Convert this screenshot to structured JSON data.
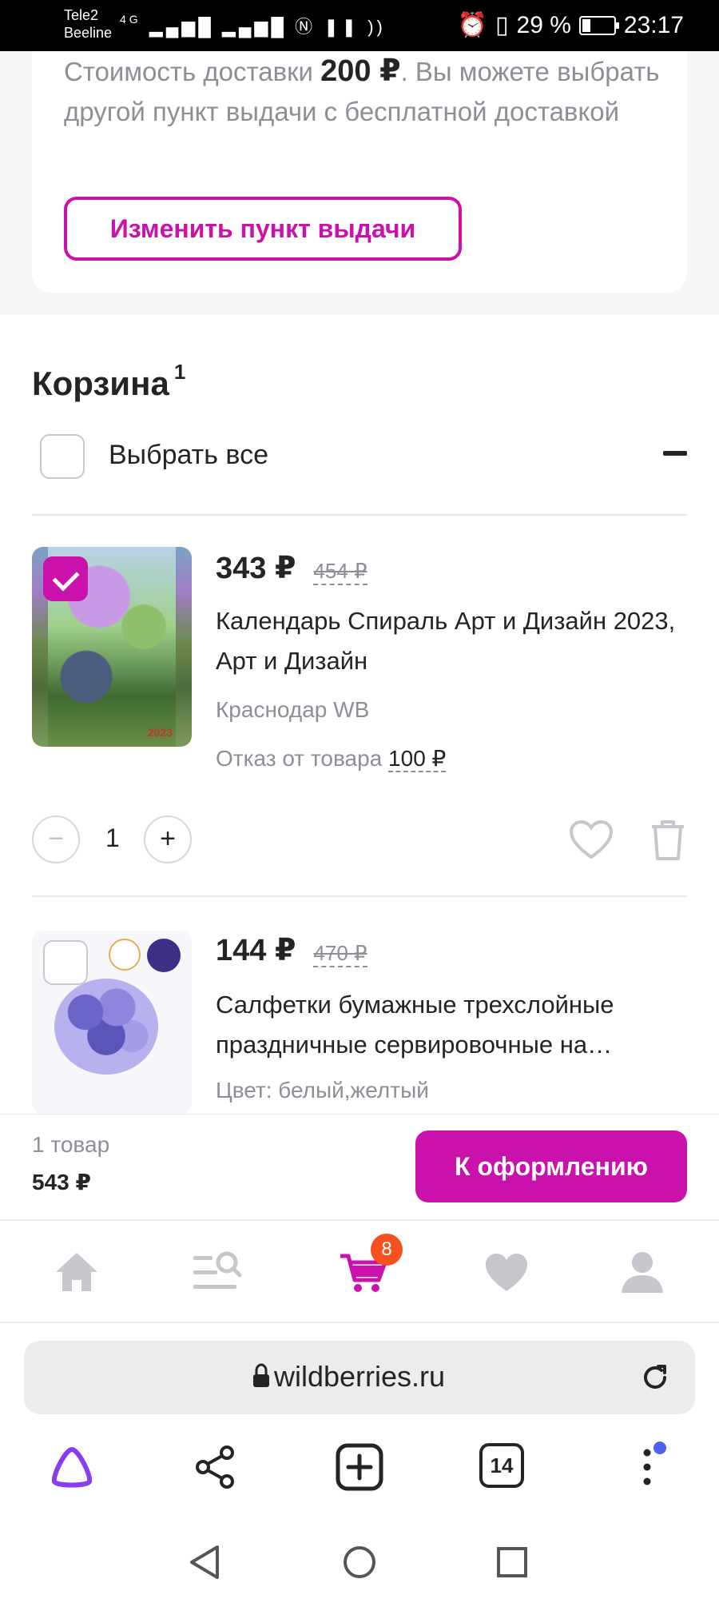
{
  "status_bar": {
    "carrier_1": "Tele2",
    "carrier_2": "Beeline",
    "network": "4G",
    "battery": "29 %",
    "time": "23:17"
  },
  "delivery": {
    "text_before": "Стоимость доставки ",
    "price": "200 ₽",
    "text_after": ". Вы можете выбрать другой пункт выдачи с бесплатной доставкой",
    "change_button": "Изменить пункт выдачи"
  },
  "cart": {
    "title": "Корзина",
    "count": "1",
    "select_all": "Выбрать все",
    "items": [
      {
        "price": "343 ₽",
        "old_price": "454 ₽",
        "title": "Календарь Спираль Арт и Дизайн 2023, Арт и Дизайн",
        "warehouse": "Краснодар WB",
        "refusal_label": "Отказ от товара",
        "refusal_value": "100 ₽",
        "quantity": "1",
        "checked": true,
        "image_text": "2023"
      },
      {
        "price": "144 ₽",
        "old_price": "470 ₽",
        "title": "Салфетки бумажные трехслойные праздничные сервировочные на…",
        "color": "Цвет: белый,желтый",
        "checked": false
      }
    ]
  },
  "checkout": {
    "count": "1 товар",
    "sum": "543 ₽",
    "button": "К оформлению"
  },
  "app_nav": {
    "items": [
      "home-icon",
      "catalog-search-icon",
      "cart-icon",
      "favorites-icon",
      "profile-icon"
    ],
    "cart_badge": "8",
    "active": "cart-icon"
  },
  "browser": {
    "url": "wildberries.ru",
    "tabs_count": "14"
  },
  "colors": {
    "accent": "#cb11ab",
    "badge": "#f5511f",
    "muted_text": "#8e8e96"
  }
}
